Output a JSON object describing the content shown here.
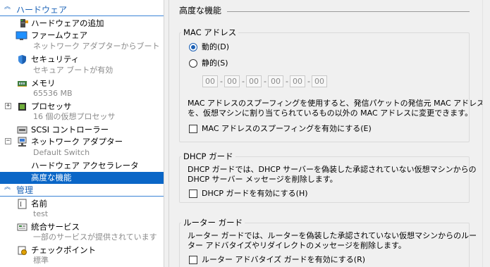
{
  "sidebar": {
    "hardware_section": "ハードウェア",
    "management_section": "管理",
    "items": [
      {
        "label": "ハードウェアの追加",
        "sub": ""
      },
      {
        "label": "ファームウェア",
        "sub": "ネットワーク アダプターからブート"
      },
      {
        "label": "セキュリティ",
        "sub": "セキュア ブートが有効"
      },
      {
        "label": "メモリ",
        "sub": "65536 MB"
      },
      {
        "label": "プロセッサ",
        "sub": "16 個の仮想プロセッサ"
      },
      {
        "label": "SCSI コントローラー",
        "sub": ""
      },
      {
        "label": "ネットワーク アダプター",
        "sub": "Default Switch"
      },
      {
        "label": "ハードウェア アクセラレータ",
        "sub": ""
      },
      {
        "label": "高度な機能",
        "sub": ""
      }
    ],
    "management_items": [
      {
        "label": "名前",
        "sub": "test"
      },
      {
        "label": "統合サービス",
        "sub": "一部のサービスが提供されています"
      },
      {
        "label": "チェックポイント",
        "sub": "標準"
      }
    ]
  },
  "panel": {
    "heading": "高度な機能",
    "mac": {
      "group_title": "MAC アドレス",
      "dynamic_label": "動的(D)",
      "static_label": "静的(S)",
      "octets": [
        "00",
        "00",
        "00",
        "00",
        "00",
        "00"
      ],
      "desc_line1": "MAC アドレスのスプーフィングを使用すると、発信パケットの発信元 MAC アドレス",
      "desc_line2": "を、仮想マシンに割り当てられているもの以外の MAC アドレスに変更できます。",
      "spoof_label": "MAC アドレスのスプーフィングを有効にする(E)"
    },
    "dhcp": {
      "group_title": "DHCP ガード",
      "desc_line1": "DHCP ガードでは、DHCP サーバーを偽装した承認されていない仮想マシンからの",
      "desc_line2": "DHCP サーバー メッセージを削除します。",
      "enable_label": "DHCP ガードを有効にする(H)"
    },
    "router": {
      "group_title": "ルーター ガード",
      "desc_line1": "ルーター ガードでは、ルーターを偽装した承認されていない仮想マシンからのルー",
      "desc_line2": "ター アドバタイズやリダイレクトのメッセージを削除します。",
      "enable_label": "ルーター アドバタイズ ガードを有効にする(R)"
    }
  },
  "colors": {
    "accent": "#1c63b7",
    "selection": "#0a66c7",
    "panel_bg": "#f0f0f0"
  }
}
